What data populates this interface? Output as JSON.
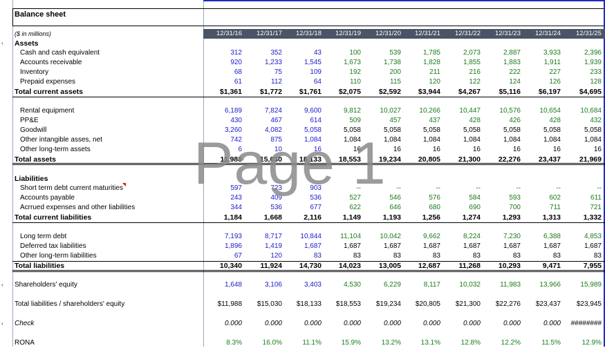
{
  "sheet": {
    "title": "Balance sheet",
    "units": "($ in millions)",
    "watermark": "Page 1",
    "years": [
      "12/31/16",
      "12/31/17",
      "12/31/18",
      "12/31/19",
      "12/31/20",
      "12/31/21",
      "12/31/22",
      "12/31/23",
      "12/31/24",
      "12/31/25"
    ]
  },
  "rows": [
    {
      "label": "Assets",
      "style": "bold",
      "values": []
    },
    {
      "label": "Cash and cash equivalent",
      "style": "indent",
      "values": [
        "312",
        "352",
        "43",
        "100",
        "539",
        "1,785",
        "2,073",
        "2,887",
        "3,933",
        "2,396"
      ],
      "colors": [
        "blue",
        "blue",
        "blue",
        "green",
        "green",
        "green",
        "green",
        "green",
        "green",
        "green"
      ]
    },
    {
      "label": "Accounts receivable",
      "style": "indent",
      "values": [
        "920",
        "1,233",
        "1,545",
        "1,673",
        "1,738",
        "1,828",
        "1,855",
        "1,883",
        "1,911",
        "1,939"
      ],
      "colors": [
        "blue",
        "blue",
        "blue",
        "green",
        "green",
        "green",
        "green",
        "green",
        "green",
        "green"
      ]
    },
    {
      "label": "Inventory",
      "style": "indent",
      "values": [
        "68",
        "75",
        "109",
        "192",
        "200",
        "211",
        "216",
        "222",
        "227",
        "233"
      ],
      "colors": [
        "blue",
        "blue",
        "blue",
        "green",
        "green",
        "green",
        "green",
        "green",
        "green",
        "green"
      ]
    },
    {
      "label": "Prepaid expenses",
      "style": "indent",
      "values": [
        "61",
        "112",
        "64",
        "110",
        "115",
        "120",
        "122",
        "124",
        "126",
        "128"
      ],
      "colors": [
        "blue",
        "blue",
        "blue",
        "green",
        "green",
        "green",
        "green",
        "green",
        "green",
        "green"
      ]
    },
    {
      "label": "Total current assets",
      "style": "bold",
      "values": [
        "$1,361",
        "$1,772",
        "$1,761",
        "$2,075",
        "$2,592",
        "$3,944",
        "$4,267",
        "$5,116",
        "$6,197",
        "$4,695"
      ]
    },
    {
      "label": "Rental equipment",
      "style": "indent",
      "values": [
        "6,189",
        "7,824",
        "9,600",
        "9,812",
        "10,027",
        "10,266",
        "10,447",
        "10,576",
        "10,654",
        "10,684"
      ],
      "colors": [
        "blue",
        "blue",
        "blue",
        "green",
        "green",
        "green",
        "green",
        "green",
        "green",
        "green"
      ]
    },
    {
      "label": "PP&E",
      "style": "indent",
      "values": [
        "430",
        "467",
        "614",
        "509",
        "457",
        "437",
        "428",
        "426",
        "428",
        "432"
      ],
      "colors": [
        "blue",
        "blue",
        "blue",
        "green",
        "green",
        "green",
        "green",
        "green",
        "green",
        "green"
      ]
    },
    {
      "label": "Goodwill",
      "style": "indent",
      "values": [
        "3,260",
        "4,082",
        "5,058",
        "5,058",
        "5,058",
        "5,058",
        "5,058",
        "5,058",
        "5,058",
        "5,058"
      ],
      "colors": [
        "blue",
        "blue",
        "blue",
        "black",
        "black",
        "black",
        "black",
        "black",
        "black",
        "black"
      ]
    },
    {
      "label": "Other intangible asses, net",
      "style": "indent",
      "values": [
        "742",
        "875",
        "1,084",
        "1,084",
        "1,084",
        "1,084",
        "1,084",
        "1,084",
        "1,084",
        "1,084"
      ],
      "colors": [
        "blue",
        "blue",
        "blue",
        "black",
        "black",
        "black",
        "black",
        "black",
        "black",
        "black"
      ]
    },
    {
      "label": "Other long-term assets",
      "style": "indent",
      "values": [
        "6",
        "10",
        "16",
        "16",
        "16",
        "16",
        "16",
        "16",
        "16",
        "16"
      ],
      "colors": [
        "blue",
        "blue",
        "blue",
        "black",
        "black",
        "black",
        "black",
        "black",
        "black",
        "black"
      ]
    },
    {
      "label": "Total assets",
      "style": "bold",
      "values": [
        "11,988",
        "15,030",
        "18,133",
        "18,553",
        "19,234",
        "20,805",
        "21,300",
        "22,276",
        "23,437",
        "21,969"
      ]
    },
    {
      "label": "Liabilities",
      "style": "bold",
      "values": []
    },
    {
      "label": "Short term debt  current maturities",
      "style": "indent",
      "values": [
        "597",
        "723",
        "903",
        "--",
        "--",
        "--",
        "--",
        "--",
        "--",
        "--"
      ],
      "colors": [
        "blue",
        "blue",
        "blue",
        "green",
        "green",
        "green",
        "green",
        "green",
        "green",
        "green"
      ]
    },
    {
      "label": "Accounts payable",
      "style": "indent",
      "values": [
        "243",
        "409",
        "536",
        "527",
        "546",
        "576",
        "584",
        "593",
        "602",
        "611"
      ],
      "colors": [
        "blue",
        "blue",
        "blue",
        "green",
        "green",
        "green",
        "green",
        "green",
        "green",
        "green"
      ]
    },
    {
      "label": "Acrrued expenses and other liabilities",
      "style": "indent",
      "values": [
        "344",
        "536",
        "677",
        "622",
        "646",
        "680",
        "690",
        "700",
        "711",
        "721"
      ],
      "colors": [
        "blue",
        "blue",
        "blue",
        "green",
        "green",
        "green",
        "green",
        "green",
        "green",
        "green"
      ]
    },
    {
      "label": "Total current liabilities",
      "style": "bold",
      "values": [
        "1,184",
        "1,668",
        "2,116",
        "1,149",
        "1,193",
        "1,256",
        "1,274",
        "1,293",
        "1,313",
        "1,332"
      ]
    },
    {
      "label": "Long term debt",
      "style": "indent",
      "values": [
        "7,193",
        "8,717",
        "10,844",
        "11,104",
        "10,042",
        "9,662",
        "8,224",
        "7,230",
        "6,388",
        "4,853"
      ],
      "colors": [
        "blue",
        "blue",
        "blue",
        "green",
        "green",
        "green",
        "green",
        "green",
        "green",
        "green"
      ]
    },
    {
      "label": "Deferred tax liabilities",
      "style": "indent",
      "values": [
        "1,896",
        "1,419",
        "1,687",
        "1,687",
        "1,687",
        "1,687",
        "1,687",
        "1,687",
        "1,687",
        "1,687"
      ],
      "colors": [
        "blue",
        "blue",
        "blue",
        "black",
        "black",
        "black",
        "black",
        "black",
        "black",
        "black"
      ]
    },
    {
      "label": "Other long-term liabilities",
      "style": "indent",
      "values": [
        "67",
        "120",
        "83",
        "83",
        "83",
        "83",
        "83",
        "83",
        "83",
        "83"
      ],
      "colors": [
        "blue",
        "blue",
        "blue",
        "black",
        "black",
        "black",
        "black",
        "black",
        "black",
        "black"
      ]
    },
    {
      "label": "Total liabilities",
      "style": "bold",
      "values": [
        "10,340",
        "11,924",
        "14,730",
        "14,023",
        "13,005",
        "12,687",
        "11,268",
        "10,293",
        "9,471",
        "7,955"
      ]
    },
    {
      "label": "Shareholders' equity",
      "style": "plain",
      "values": [
        "1,648",
        "3,106",
        "3,403",
        "4,530",
        "6,229",
        "8,117",
        "10,032",
        "11,983",
        "13,966",
        "15,989"
      ],
      "colors": [
        "blue",
        "blue",
        "blue",
        "green",
        "green",
        "green",
        "green",
        "green",
        "green",
        "green"
      ]
    },
    {
      "label": "Total liabilities / shareholders' equity",
      "style": "plain",
      "values": [
        "$11,988",
        "$15,030",
        "$18,133",
        "$18,553",
        "$19,234",
        "$20,805",
        "$21,300",
        "$22,276",
        "$23,437",
        "$23,945"
      ]
    },
    {
      "label": "Check",
      "style": "ital",
      "values": [
        "0.000",
        "0.000",
        "0.000",
        "0.000",
        "0.000",
        "0.000",
        "0.000",
        "0.000",
        "0.000",
        "########"
      ]
    },
    {
      "label": "RONA",
      "style": "plain",
      "values": [
        "8.3%",
        "16.0%",
        "11.1%",
        "15.9%",
        "13.2%",
        "13.1%",
        "12.8%",
        "12.2%",
        "11.5%",
        "12.9%"
      ],
      "colors": [
        "green",
        "green",
        "green",
        "green",
        "green",
        "green",
        "green",
        "green",
        "green",
        "green"
      ]
    }
  ]
}
